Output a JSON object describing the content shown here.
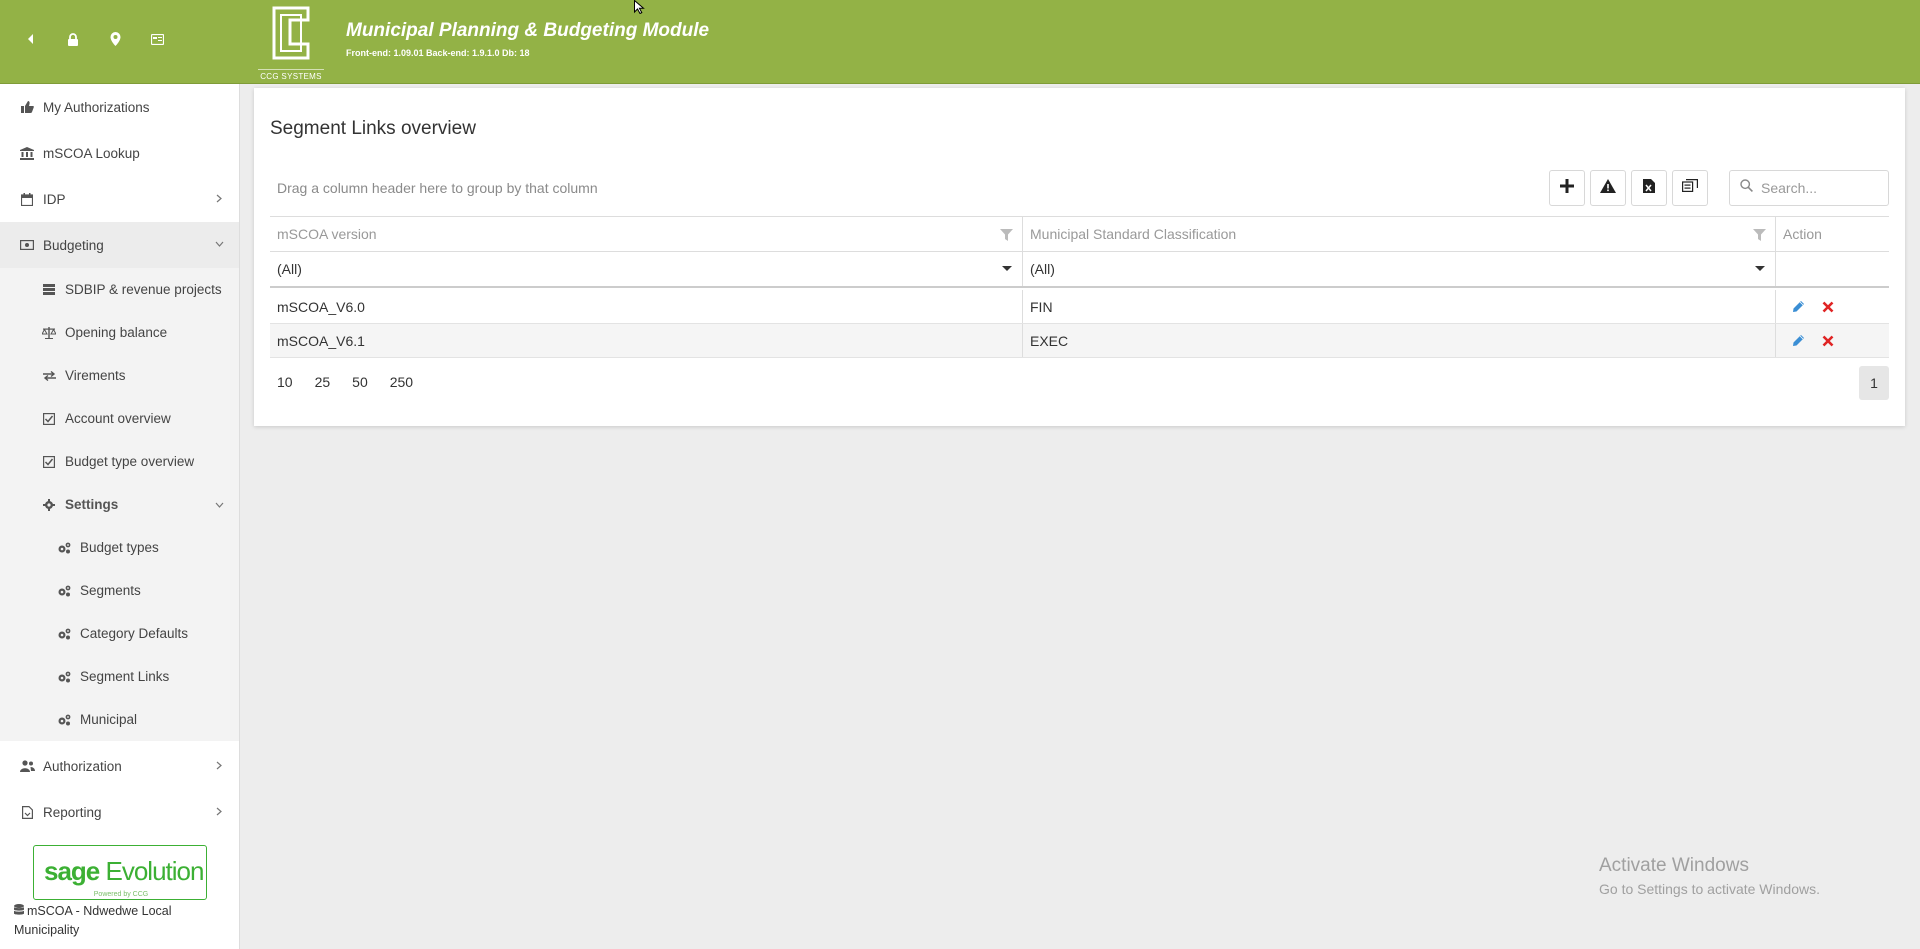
{
  "header": {
    "title": "Municipal Planning & Budgeting Module",
    "version": "Front-end: 1.09.01 Back-end: 1.9.1.0 Db: 18",
    "logo_text": "CCG SYSTEMS",
    "icons": [
      "back-arrow-icon",
      "lock-icon",
      "map-marker-icon",
      "id-card-icon"
    ],
    "color": "#93b246"
  },
  "sidebar": {
    "items": [
      {
        "label": "My Authorizations",
        "icon": "thumbs-up-icon"
      },
      {
        "label": "mSCOA Lookup",
        "icon": "bank-icon"
      },
      {
        "label": "IDP",
        "icon": "calendar-icon"
      },
      {
        "label": "Budgeting",
        "icon": "money-icon"
      },
      {
        "label": "Authorization",
        "icon": "users-icon"
      },
      {
        "label": "Reporting",
        "icon": "report-icon"
      }
    ],
    "budgeting_children": [
      {
        "label": "SDBIP & revenue projects",
        "icon": "list-icon"
      },
      {
        "label": "Opening balance",
        "icon": "scale-icon"
      },
      {
        "label": "Virements",
        "icon": "exchange-icon"
      },
      {
        "label": "Account overview",
        "icon": "check-square-icon"
      },
      {
        "label": "Budget type overview",
        "icon": "check-square-icon"
      },
      {
        "label": "Settings",
        "icon": "gear-icon"
      }
    ],
    "settings_children": [
      {
        "label": "Budget types",
        "icon": "gears-icon"
      },
      {
        "label": "Segments",
        "icon": "gears-icon"
      },
      {
        "label": "Category Defaults",
        "icon": "gears-icon"
      },
      {
        "label": "Segment Links",
        "icon": "gears-icon"
      },
      {
        "label": "Municipal",
        "icon": "gears-icon"
      }
    ],
    "sage_brand": "sage",
    "sage_product": "Evolution",
    "sage_powered": "Powered by CCG",
    "database_label": "mSCOA - Ndwedwe Local Municipality"
  },
  "main": {
    "page_title": "Segment Links overview",
    "group_panel_text": "Drag a column header here to group by that column",
    "toolbar": [
      "add-icon",
      "warning-icon",
      "export-excel-icon",
      "column-chooser-icon"
    ],
    "search": {
      "placeholder": "Search..."
    },
    "columns": [
      "mSCOA version",
      "Municipal Standard Classification",
      "Action"
    ],
    "filters": [
      "(All)",
      "(All)"
    ],
    "rows": [
      {
        "version": "mSCOA_V6.0",
        "classification": "FIN"
      },
      {
        "version": "mSCOA_V6.1",
        "classification": "EXEC"
      }
    ],
    "page_sizes": [
      "10",
      "25",
      "50",
      "250"
    ],
    "current_page": "1"
  },
  "watermark": {
    "title": "Activate Windows",
    "subtitle": "Go to Settings to activate Windows."
  }
}
